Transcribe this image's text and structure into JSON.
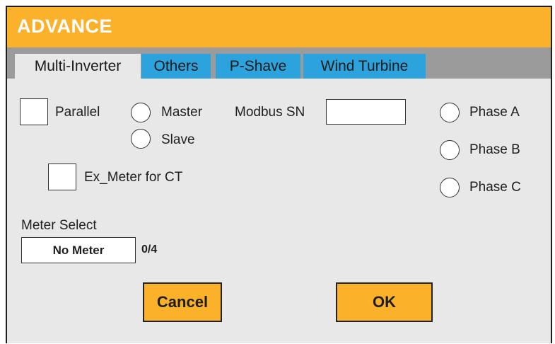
{
  "window": {
    "title": "ADVANCE"
  },
  "tabs": [
    {
      "label": "Multi-Inverter",
      "active": true
    },
    {
      "label": "Others",
      "active": false
    },
    {
      "label": "P-Shave",
      "active": false
    },
    {
      "label": "Wind Turbine",
      "active": false
    }
  ],
  "parallel": {
    "label": "Parallel",
    "checked": false
  },
  "role": {
    "master_label": "Master",
    "slave_label": "Slave",
    "selected": null
  },
  "modbus": {
    "label": "Modbus SN",
    "value": ""
  },
  "phase": {
    "a_label": "Phase A",
    "b_label": "Phase B",
    "c_label": "Phase C",
    "selected": null
  },
  "ex_meter": {
    "label": "Ex_Meter for CT",
    "checked": false
  },
  "meter_select": {
    "label": "Meter Select",
    "value": "No Meter",
    "count": "0/4"
  },
  "buttons": {
    "cancel": "Cancel",
    "ok": "OK"
  },
  "colors": {
    "accent": "#fbb12a",
    "tab_inactive": "#2ca3dc",
    "tabbar": "#9b9b9b",
    "panel": "#e8e8e8"
  }
}
